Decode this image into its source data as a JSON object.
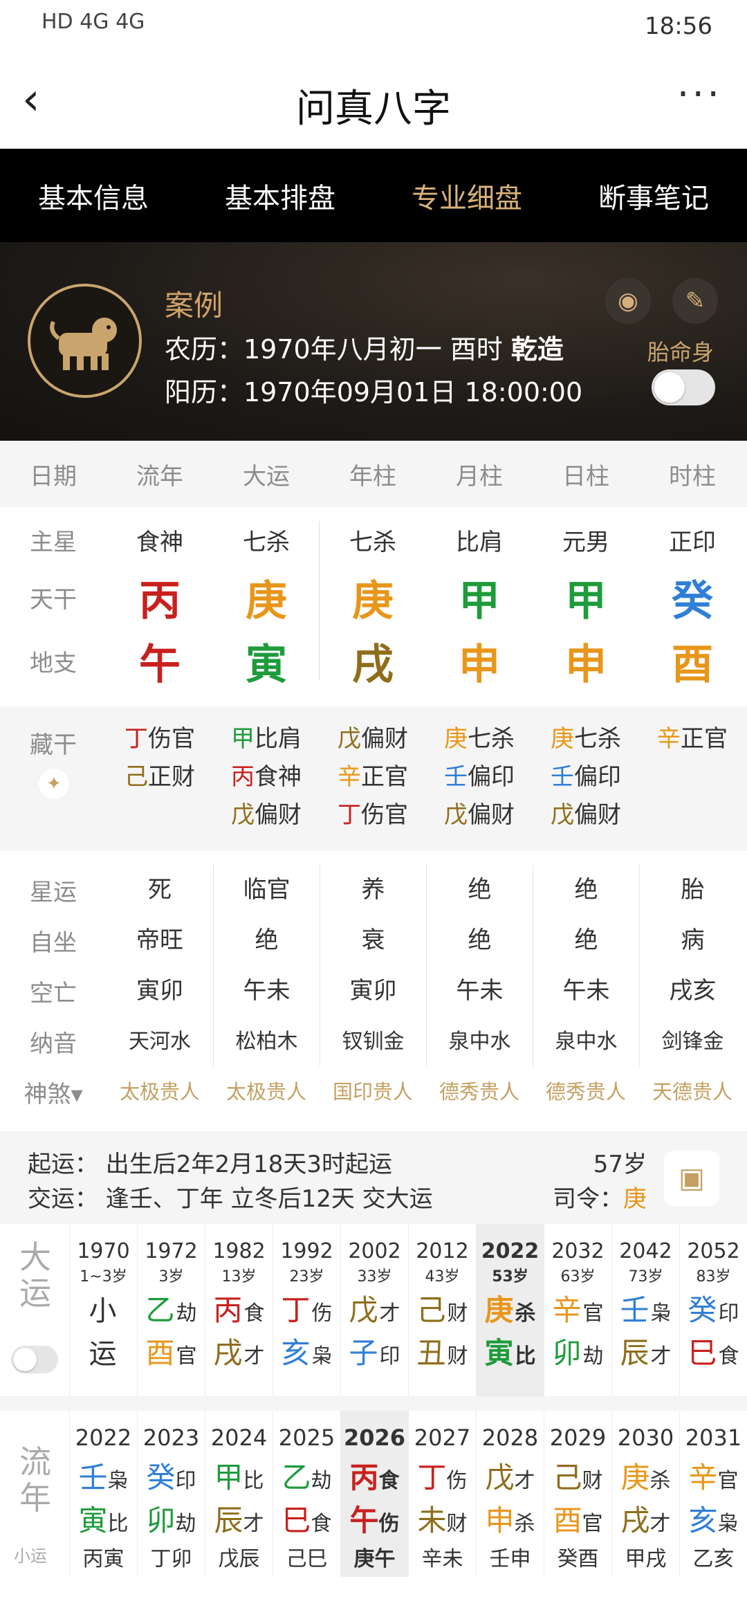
{
  "status": {
    "left": "HD 4G 4G",
    "time": "18:56"
  },
  "header": {
    "title": "问真八字"
  },
  "tabs": [
    "基本信息",
    "基本排盘",
    "专业细盘",
    "断事笔记"
  ],
  "active_tab": 2,
  "profile": {
    "name": "案例",
    "lunar_prefix": "农历：1970年八月初一 酉时 ",
    "lunar_gender": "乾造",
    "solar": "阳历：1970年09月01日 18:00:00",
    "taimingshen": "胎命身"
  },
  "columns": [
    "日期",
    "流年",
    "大运",
    "年柱",
    "月柱",
    "日柱",
    "时柱"
  ],
  "main_star": {
    "label": "主星",
    "values": [
      "食神",
      "七杀",
      "七杀",
      "比肩",
      "元男",
      "正印"
    ]
  },
  "tiangan": {
    "label": "天干",
    "values": [
      "丙",
      "庚",
      "庚",
      "甲",
      "甲",
      "癸"
    ],
    "colors": [
      "r",
      "o",
      "o",
      "g",
      "g",
      "b"
    ]
  },
  "dizhi": {
    "label": "地支",
    "values": [
      "午",
      "寅",
      "戌",
      "申",
      "申",
      "酉"
    ],
    "colors": [
      "r",
      "g",
      "br",
      "o",
      "o",
      "o"
    ]
  },
  "canggan": {
    "label": "藏干",
    "cols": [
      [
        [
          "丁",
          "伤官",
          "r"
        ],
        [
          "己",
          "正财",
          "br"
        ]
      ],
      [
        [
          "甲",
          "比肩",
          "g"
        ],
        [
          "丙",
          "食神",
          "r"
        ],
        [
          "戊",
          "偏财",
          "br"
        ]
      ],
      [
        [
          "戊",
          "偏财",
          "br"
        ],
        [
          "辛",
          "正官",
          "o"
        ],
        [
          "丁",
          "伤官",
          "r"
        ]
      ],
      [
        [
          "庚",
          "七杀",
          "o"
        ],
        [
          "壬",
          "偏印",
          "b"
        ],
        [
          "戊",
          "偏财",
          "br"
        ]
      ],
      [
        [
          "庚",
          "七杀",
          "o"
        ],
        [
          "壬",
          "偏印",
          "b"
        ],
        [
          "戊",
          "偏财",
          "br"
        ]
      ],
      [
        [
          "辛",
          "正官",
          "o"
        ]
      ]
    ]
  },
  "info_rows": [
    {
      "label": "星运",
      "values": [
        "死",
        "临官",
        "养",
        "绝",
        "绝",
        "胎"
      ]
    },
    {
      "label": "自坐",
      "values": [
        "帝旺",
        "绝",
        "衰",
        "绝",
        "绝",
        "病"
      ]
    },
    {
      "label": "空亡",
      "values": [
        "寅卯",
        "午未",
        "寅卯",
        "午未",
        "午未",
        "戌亥"
      ]
    },
    {
      "label": "纳音",
      "values": [
        "天河水",
        "松柏木",
        "钗钏金",
        "泉中水",
        "泉中水",
        "剑锋金"
      ]
    }
  ],
  "shensha": {
    "label": "神煞▾",
    "values": [
      "太极贵人",
      "太极贵人",
      "国印贵人",
      "德秀贵人",
      "德秀贵人",
      "天德贵人"
    ]
  },
  "qiyun": {
    "line1": "起运：  出生后2年2月18天3时起运",
    "line2": "交运：  逢壬、丁年 立冬后12天 交大运",
    "age": "57岁",
    "siling_label": "司令：",
    "siling_value": "庚"
  },
  "dayun": {
    "title": "大运",
    "cols": [
      {
        "yr": "1970",
        "ag": "1~3岁",
        "g": [
          "小",
          ""
        ],
        "gc": "",
        "z": [
          "运",
          ""
        ],
        "zc": ""
      },
      {
        "yr": "1972",
        "ag": "3岁",
        "g": [
          "乙",
          "劫"
        ],
        "gc": "g",
        "z": [
          "酉",
          "官"
        ],
        "zc": "o"
      },
      {
        "yr": "1982",
        "ag": "13岁",
        "g": [
          "丙",
          "食"
        ],
        "gc": "r",
        "z": [
          "戌",
          "才"
        ],
        "zc": "br"
      },
      {
        "yr": "1992",
        "ag": "23岁",
        "g": [
          "丁",
          "伤"
        ],
        "gc": "r",
        "z": [
          "亥",
          "枭"
        ],
        "zc": "b"
      },
      {
        "yr": "2002",
        "ag": "33岁",
        "g": [
          "戊",
          "才"
        ],
        "gc": "br",
        "z": [
          "子",
          "印"
        ],
        "zc": "b"
      },
      {
        "yr": "2012",
        "ag": "43岁",
        "g": [
          "己",
          "财"
        ],
        "gc": "br",
        "z": [
          "丑",
          "财"
        ],
        "zc": "br"
      },
      {
        "yr": "2022",
        "ag": "53岁",
        "g": [
          "庚",
          "杀"
        ],
        "gc": "o",
        "z": [
          "寅",
          "比"
        ],
        "zc": "g",
        "hl": true
      },
      {
        "yr": "2032",
        "ag": "63岁",
        "g": [
          "辛",
          "官"
        ],
        "gc": "o",
        "z": [
          "卯",
          "劫"
        ],
        "zc": "g"
      },
      {
        "yr": "2042",
        "ag": "73岁",
        "g": [
          "壬",
          "枭"
        ],
        "gc": "b",
        "z": [
          "辰",
          "才"
        ],
        "zc": "br"
      },
      {
        "yr": "2052",
        "ag": "83岁",
        "g": [
          "癸",
          "印"
        ],
        "gc": "b",
        "z": [
          "巳",
          "食"
        ],
        "zc": "r"
      }
    ]
  },
  "liunian": {
    "title": "流年",
    "sub": "小运",
    "cols": [
      {
        "yr": "2022",
        "g": [
          "壬",
          "枭"
        ],
        "gc": "b",
        "z": [
          "寅",
          "比"
        ],
        "zc": "g",
        "xy": "丙寅"
      },
      {
        "yr": "2023",
        "g": [
          "癸",
          "印"
        ],
        "gc": "b",
        "z": [
          "卯",
          "劫"
        ],
        "zc": "g",
        "xy": "丁卯"
      },
      {
        "yr": "2024",
        "g": [
          "甲",
          "比"
        ],
        "gc": "g",
        "z": [
          "辰",
          "才"
        ],
        "zc": "br",
        "xy": "戊辰"
      },
      {
        "yr": "2025",
        "g": [
          "乙",
          "劫"
        ],
        "gc": "g",
        "z": [
          "巳",
          "食"
        ],
        "zc": "r",
        "xy": "己巳"
      },
      {
        "yr": "2026",
        "g": [
          "丙",
          "食"
        ],
        "gc": "r",
        "z": [
          "午",
          "伤"
        ],
        "zc": "r",
        "xy": "庚午",
        "hl": true
      },
      {
        "yr": "2027",
        "g": [
          "丁",
          "伤"
        ],
        "gc": "r",
        "z": [
          "未",
          "财"
        ],
        "zc": "br",
        "xy": "辛未"
      },
      {
        "yr": "2028",
        "g": [
          "戊",
          "才"
        ],
        "gc": "br",
        "z": [
          "申",
          "杀"
        ],
        "zc": "o",
        "xy": "壬申"
      },
      {
        "yr": "2029",
        "g": [
          "己",
          "财"
        ],
        "gc": "br",
        "z": [
          "酉",
          "官"
        ],
        "zc": "o",
        "xy": "癸酉"
      },
      {
        "yr": "2030",
        "g": [
          "庚",
          "杀"
        ],
        "gc": "o",
        "z": [
          "戌",
          "才"
        ],
        "zc": "br",
        "xy": "甲戌"
      },
      {
        "yr": "2031",
        "g": [
          "辛",
          "官"
        ],
        "gc": "o",
        "z": [
          "亥",
          "枭"
        ],
        "zc": "b",
        "xy": "乙亥"
      }
    ]
  }
}
